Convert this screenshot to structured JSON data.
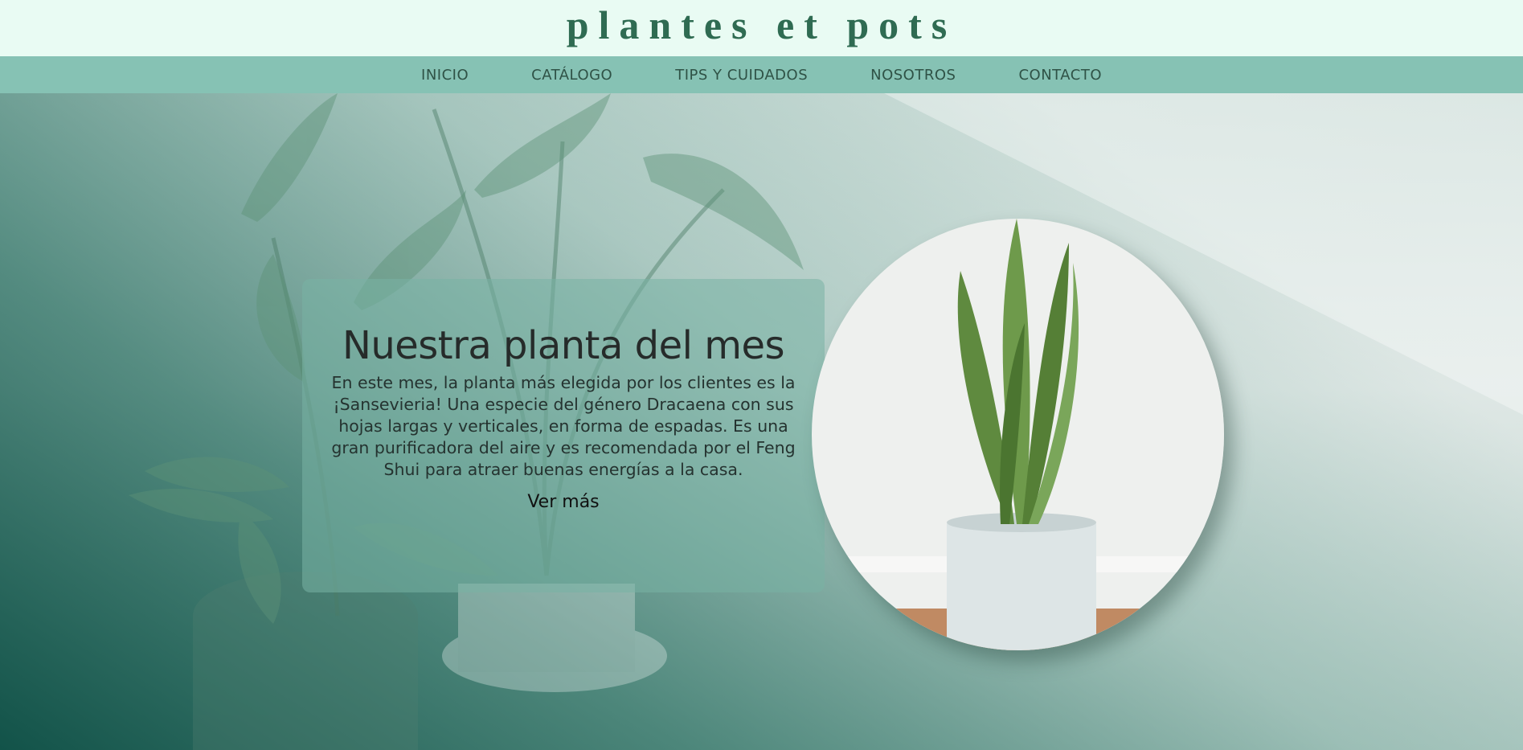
{
  "site": {
    "brand": "plantes et pots"
  },
  "nav": {
    "items": [
      {
        "label": "INICIO"
      },
      {
        "label": "CATÁLOGO"
      },
      {
        "label": "TIPS Y CUIDADOS"
      },
      {
        "label": "NOSOTROS"
      },
      {
        "label": "CONTACTO"
      }
    ]
  },
  "hero": {
    "title": "Nuestra planta del mes",
    "body": "En este mes, la planta más elegida por los clientes es la ¡Sansevieria! Una especie del género Dracaena con sus hojas largas y verticales, en forma de espadas. Es una gran purificadora del aire y es recomendada por el Feng Shui para atraer buenas energías a la casa.",
    "link_label": "Ver más"
  },
  "colors": {
    "header_bg": "#e9fbf3",
    "brand": "#2f6b52",
    "nav_bg": "#86c2b4",
    "nav_text": "#2f5246",
    "card_bg": "#78b2a4"
  }
}
